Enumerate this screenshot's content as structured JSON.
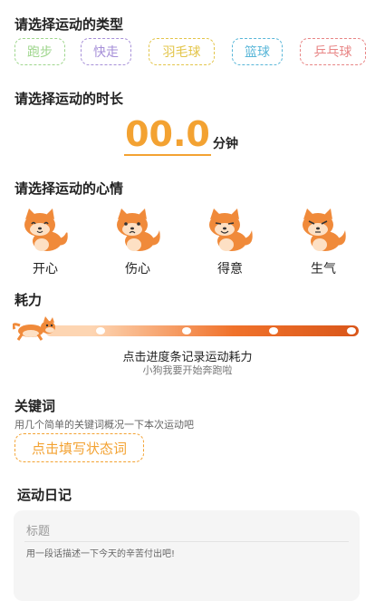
{
  "type_section": {
    "title": "请选择运动的类型",
    "chips": [
      {
        "label": "跑步",
        "color": "#9ed68c"
      },
      {
        "label": "快走",
        "color": "#a68fd8"
      },
      {
        "label": "羽毛球",
        "color": "#e3c54a"
      },
      {
        "label": "篮球",
        "color": "#58b6d8"
      },
      {
        "label": "乒乓球",
        "color": "#e88585"
      }
    ]
  },
  "duration_section": {
    "title": "请选择运动的时长",
    "value": "00.0",
    "unit": "分钟",
    "accent": "#f3a232"
  },
  "mood_section": {
    "title": "请选择运动的心情",
    "moods": [
      {
        "label": "开心",
        "icon": "happy-fox-icon"
      },
      {
        "label": "伤心",
        "icon": "sad-fox-icon"
      },
      {
        "label": "得意",
        "icon": "smug-fox-icon"
      },
      {
        "label": "生气",
        "icon": "angry-fox-icon"
      }
    ]
  },
  "effort_section": {
    "title": "耗力",
    "hint": "点击进度条记录运动耗力",
    "subhint": "小狗我要开始奔跑啦",
    "level": 0,
    "track_colors": [
      "#fdd5b2",
      "#f0722b",
      "#d9561a"
    ]
  },
  "keyword_section": {
    "title": "关键词",
    "subtitle": "用几个简单的关键词概况一下本次运动吧",
    "button_label": "点击填写状态词",
    "accent": "#f3a232"
  },
  "diary_section": {
    "title": "运动日记",
    "title_placeholder": "标题",
    "body_placeholder": "用一段话描述一下今天的辛苦付出吧!"
  }
}
